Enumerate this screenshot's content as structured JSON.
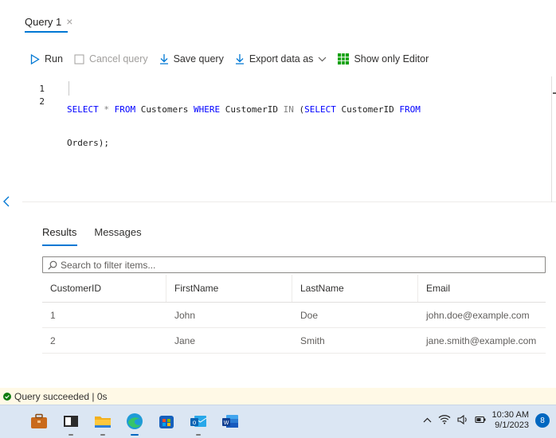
{
  "query_tab": {
    "title": "Query 1",
    "close": "×"
  },
  "toolbar": {
    "run": "Run",
    "cancel": "Cancel query",
    "save": "Save query",
    "export": "Export data as",
    "show_editor": "Show only Editor"
  },
  "editor": {
    "line_numbers": [
      "1",
      "2"
    ],
    "line1": {
      "t1": "SELECT",
      "t2": " * ",
      "t3": "FROM",
      "t4": " Customers ",
      "t5": "WHERE",
      "t6": " CustomerID ",
      "t7": "IN",
      "t8": " (",
      "t9": "SELECT",
      "t10": " CustomerID ",
      "t11": "FROM"
    },
    "line2": "Orders);"
  },
  "results": {
    "tabs": [
      "Results",
      "Messages"
    ],
    "filter_placeholder": "Search to filter items...",
    "columns": [
      "CustomerID",
      "FirstName",
      "LastName",
      "Email"
    ],
    "rows": [
      [
        "1",
        "John",
        "Doe",
        "john.doe@example.com"
      ],
      [
        "2",
        "Jane",
        "Smith",
        "jane.smith@example.com"
      ]
    ]
  },
  "status": {
    "text": "Query succeeded | 0s",
    "color": "#107c10"
  },
  "taskbar": {
    "apps": [
      "briefcase-icon",
      "window-icon",
      "file-explorer-icon",
      "edge-icon",
      "store-icon",
      "outlook-icon",
      "word-icon"
    ],
    "time": "10:30 AM",
    "date": "9/1/2023",
    "notifications": "8"
  },
  "colors": {
    "accent": "#0078d4",
    "keyword": "#0000ff",
    "status_bg": "#fff9e6"
  }
}
